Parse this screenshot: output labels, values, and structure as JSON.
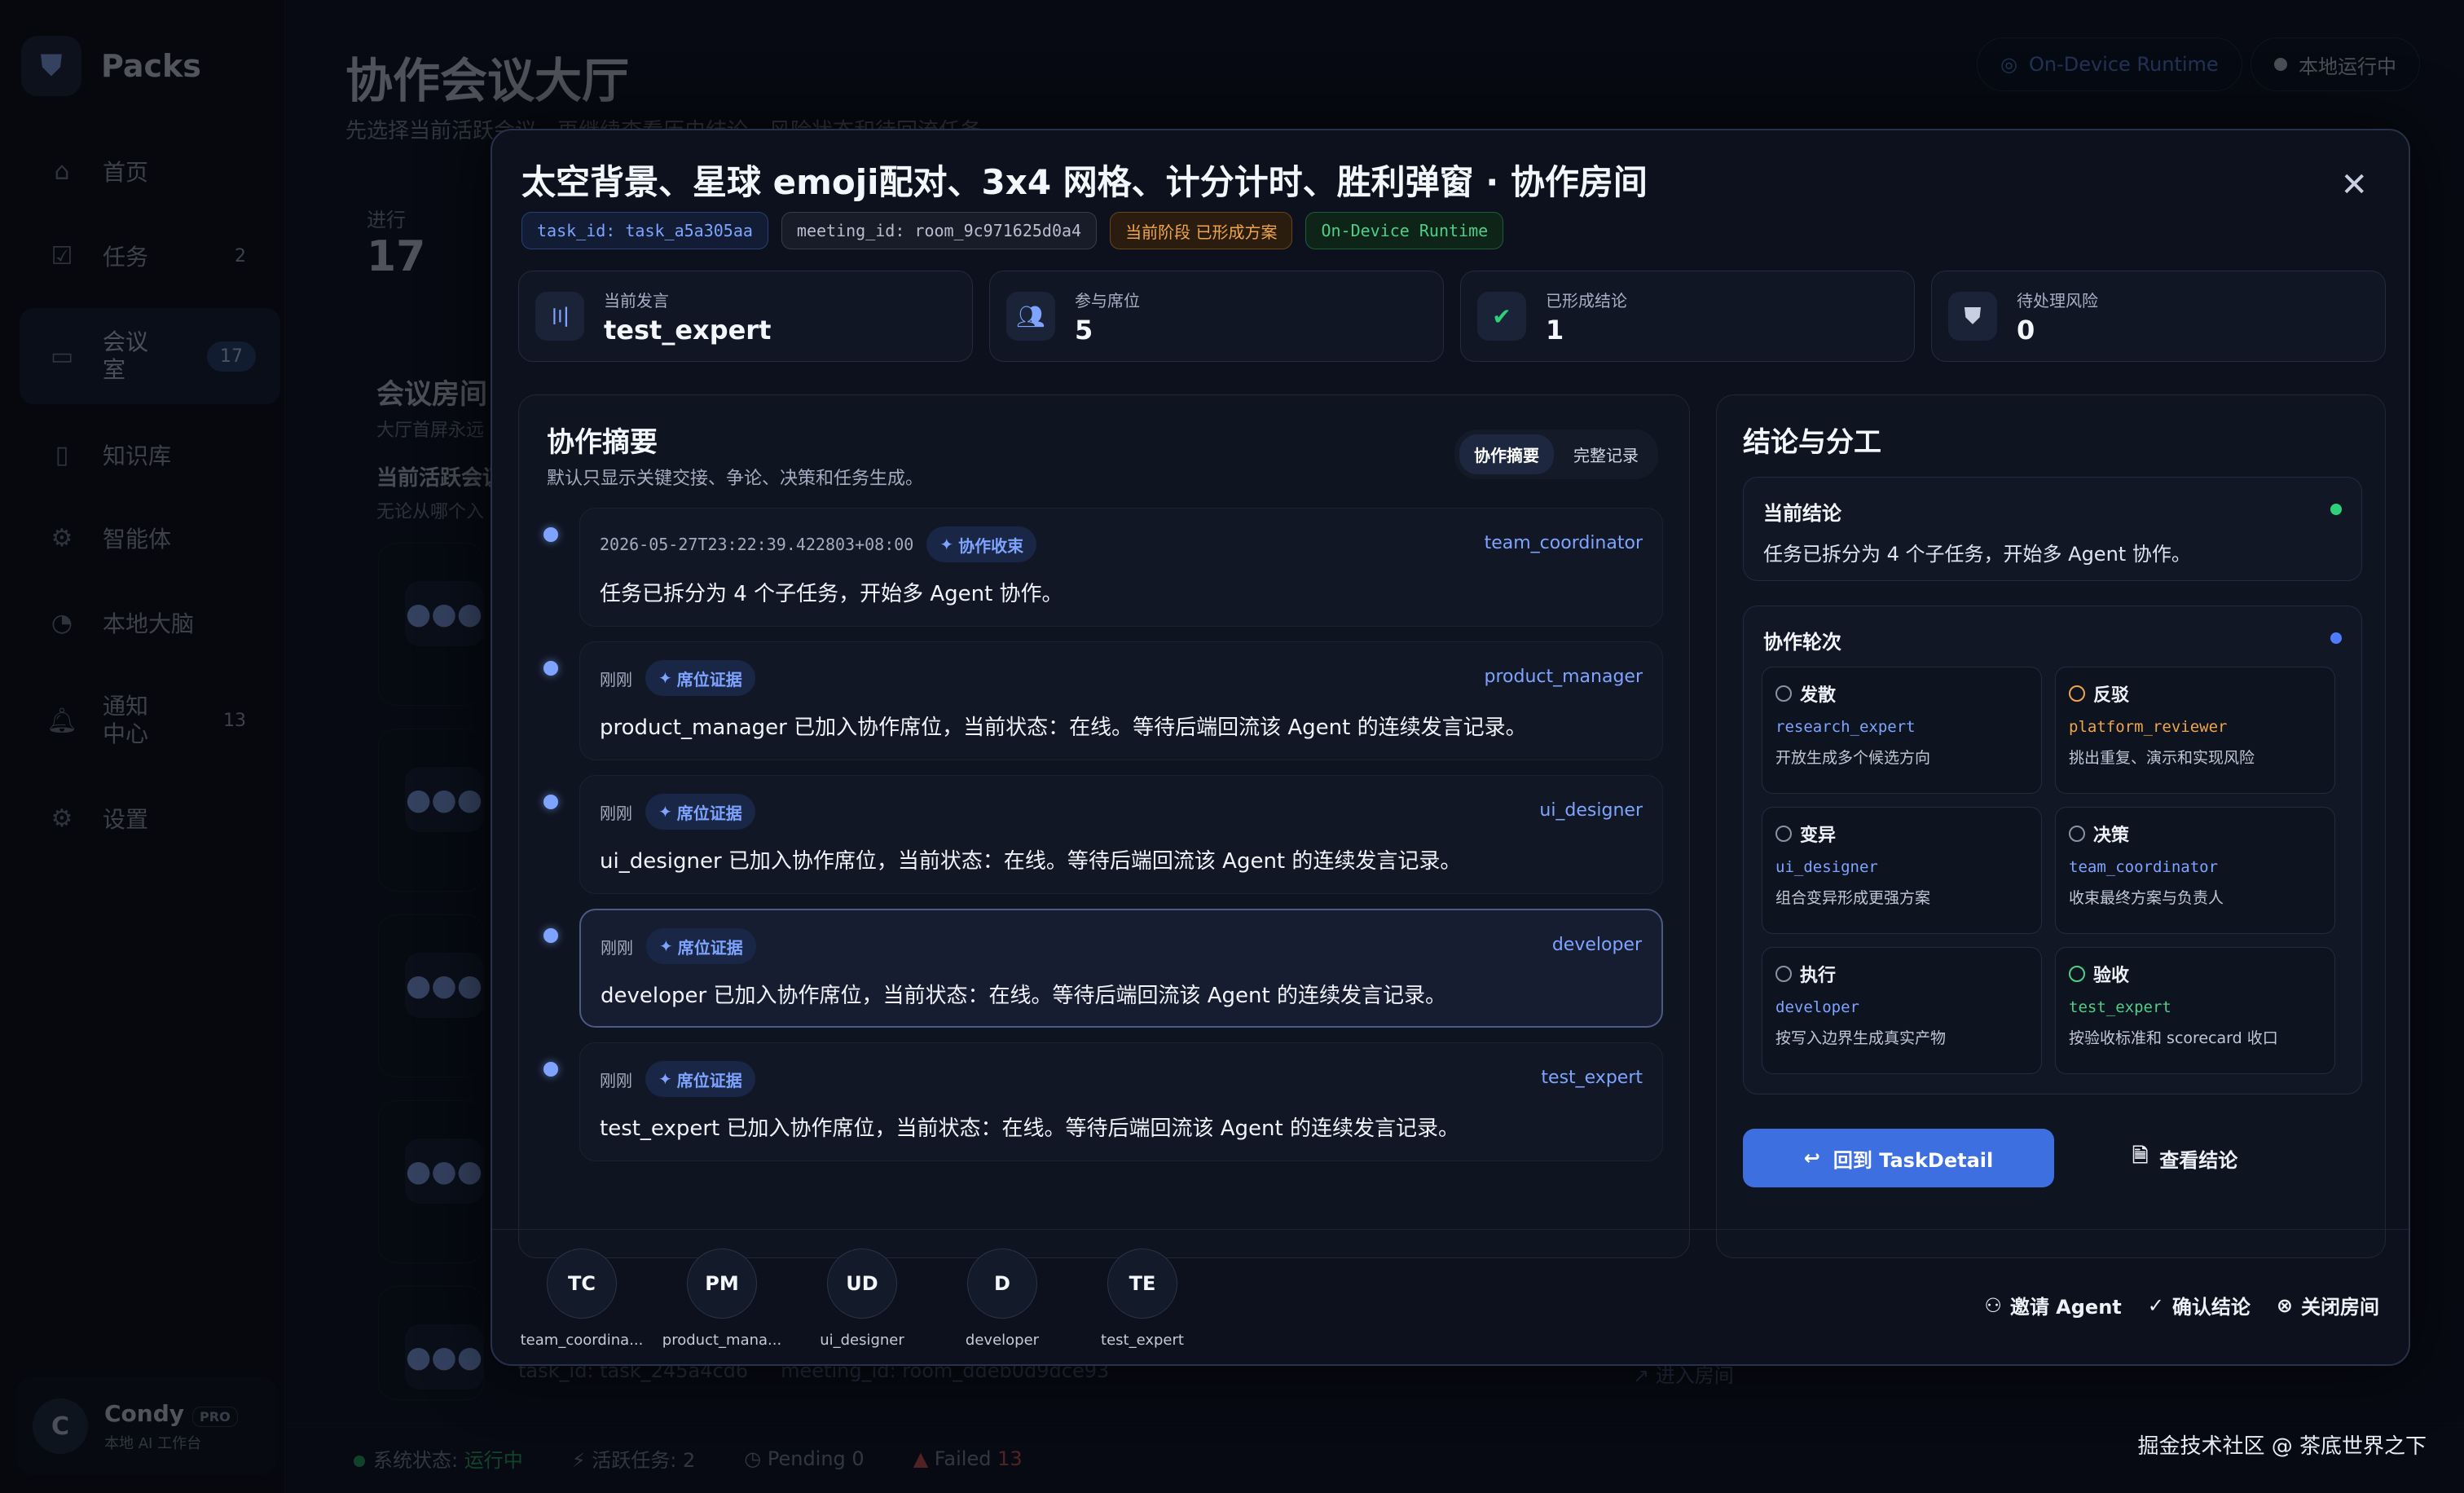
{
  "app": {
    "name": "Packs"
  },
  "sidebar": {
    "items": [
      {
        "label": "首页",
        "icon": "home-icon"
      },
      {
        "label": "任务",
        "icon": "checkbox-icon",
        "count": "2"
      },
      {
        "label": "会议室",
        "icon": "chat-icon",
        "count": "17"
      },
      {
        "label": "知识库",
        "icon": "book-icon"
      },
      {
        "label": "智能体",
        "icon": "agents-icon"
      },
      {
        "label": "本地大脑",
        "icon": "brain-icon"
      },
      {
        "label": "通知中心",
        "icon": "bell-icon",
        "count": "13"
      },
      {
        "label": "设置",
        "icon": "gear-icon"
      }
    ],
    "user": {
      "initial": "C",
      "name": "Condy",
      "badge": "PRO",
      "sub": "本地 AI 工作台"
    }
  },
  "header": {
    "title": "协作会议大厅",
    "subtitle": "先选择当前活跃会议，再继续查看历史结论、风险状态和待回流任务。",
    "runtime_chip": "On-Device Runtime",
    "local_chip": "本地运行中"
  },
  "background": {
    "stat_label": "进行",
    "stat_value": "17",
    "rooms_title": "会议房间",
    "rooms_sub": "大厅首屏永远",
    "active_title": "当前活跃会议",
    "active_sub": "无论从哪个入",
    "bottom_task": "task_id: task_245a4cd6",
    "bottom_meeting": "meeting_id: room_ddeb0d9dce93",
    "enter_room": "进入房间",
    "status": {
      "system_label": "系统状态:",
      "system_value": "运行中",
      "active_tasks_label": "活跃任务:",
      "active_tasks_value": "2",
      "pending": "Pending 0",
      "failed_label": "Failed",
      "failed_value": "13"
    }
  },
  "modal": {
    "title": "太空背景、星球 emoji配对、3x4 网格、计分计时、胜利弹窗 · 协作房间",
    "tags": {
      "task_id": "task_id: task_a5a305aa",
      "meeting_id": "meeting_id: room_9c971625d0a4",
      "stage": "当前阶段 已形成方案",
      "runtime": "On-Device Runtime"
    },
    "stats": [
      {
        "label": "当前发言",
        "value": "test_expert",
        "icon": "voice-icon"
      },
      {
        "label": "参与席位",
        "value": "5",
        "icon": "users-icon"
      },
      {
        "label": "已形成结论",
        "value": "1",
        "icon": "shield-check-icon"
      },
      {
        "label": "待处理风险",
        "value": "0",
        "icon": "shield-alert-icon"
      }
    ],
    "summary": {
      "title": "协作摘要",
      "subtitle": "默认只显示关键交接、争论、决策和任务生成。",
      "tab_summary": "协作摘要",
      "tab_full": "完整记录",
      "items": [
        {
          "time": "2026-05-27T23:22:39.422803+08:00",
          "badge": "协作收束",
          "who": "team_coordinator",
          "text": "任务已拆分为 4 个子任务，开始多 Agent 协作。"
        },
        {
          "time": "刚刚",
          "badge": "席位证据",
          "who": "product_manager",
          "text": "product_manager 已加入协作席位，当前状态：在线。等待后端回流该 Agent 的连续发言记录。"
        },
        {
          "time": "刚刚",
          "badge": "席位证据",
          "who": "ui_designer",
          "text": "ui_designer 已加入协作席位，当前状态：在线。等待后端回流该 Agent 的连续发言记录。"
        },
        {
          "time": "刚刚",
          "badge": "席位证据",
          "who": "developer",
          "text": "developer 已加入协作席位，当前状态：在线。等待后端回流该 Agent 的连续发言记录。"
        },
        {
          "time": "刚刚",
          "badge": "席位证据",
          "who": "test_expert",
          "text": "test_expert 已加入协作席位，当前状态：在线。等待后端回流该 Agent 的连续发言记录。"
        }
      ]
    },
    "conclusion": {
      "title": "结论与分工",
      "current_title": "当前结论",
      "current_text": "任务已拆分为 4 个子任务，开始多 Agent 协作。",
      "rounds_title": "协作轮次",
      "rounds": [
        {
          "title": "发散",
          "who": "research_expert",
          "desc": "开放生成多个候选方向"
        },
        {
          "title": "反驳",
          "who": "platform_reviewer",
          "desc": "挑出重复、演示和实现风险"
        },
        {
          "title": "变异",
          "who": "ui_designer",
          "desc": "组合变异形成更强方案"
        },
        {
          "title": "决策",
          "who": "team_coordinator",
          "desc": "收束最终方案与负责人"
        },
        {
          "title": "执行",
          "who": "developer",
          "desc": "按写入边界生成真实产物"
        },
        {
          "title": "验收",
          "who": "test_expert",
          "desc": "按验收标准和 scorecard 收口"
        }
      ],
      "back_button": "回到 TaskDetail",
      "view_button": "查看结论"
    },
    "agents": [
      {
        "initials": "TC",
        "name": "team_coordina..."
      },
      {
        "initials": "PM",
        "name": "product_mana..."
      },
      {
        "initials": "UD",
        "name": "ui_designer"
      },
      {
        "initials": "D",
        "name": "developer"
      },
      {
        "initials": "TE",
        "name": "test_expert"
      }
    ],
    "actions": {
      "invite": "邀请 Agent",
      "confirm": "确认结论",
      "close": "关闭房间"
    }
  },
  "watermark": "掘金技术社区 @ 茶底世界之下"
}
